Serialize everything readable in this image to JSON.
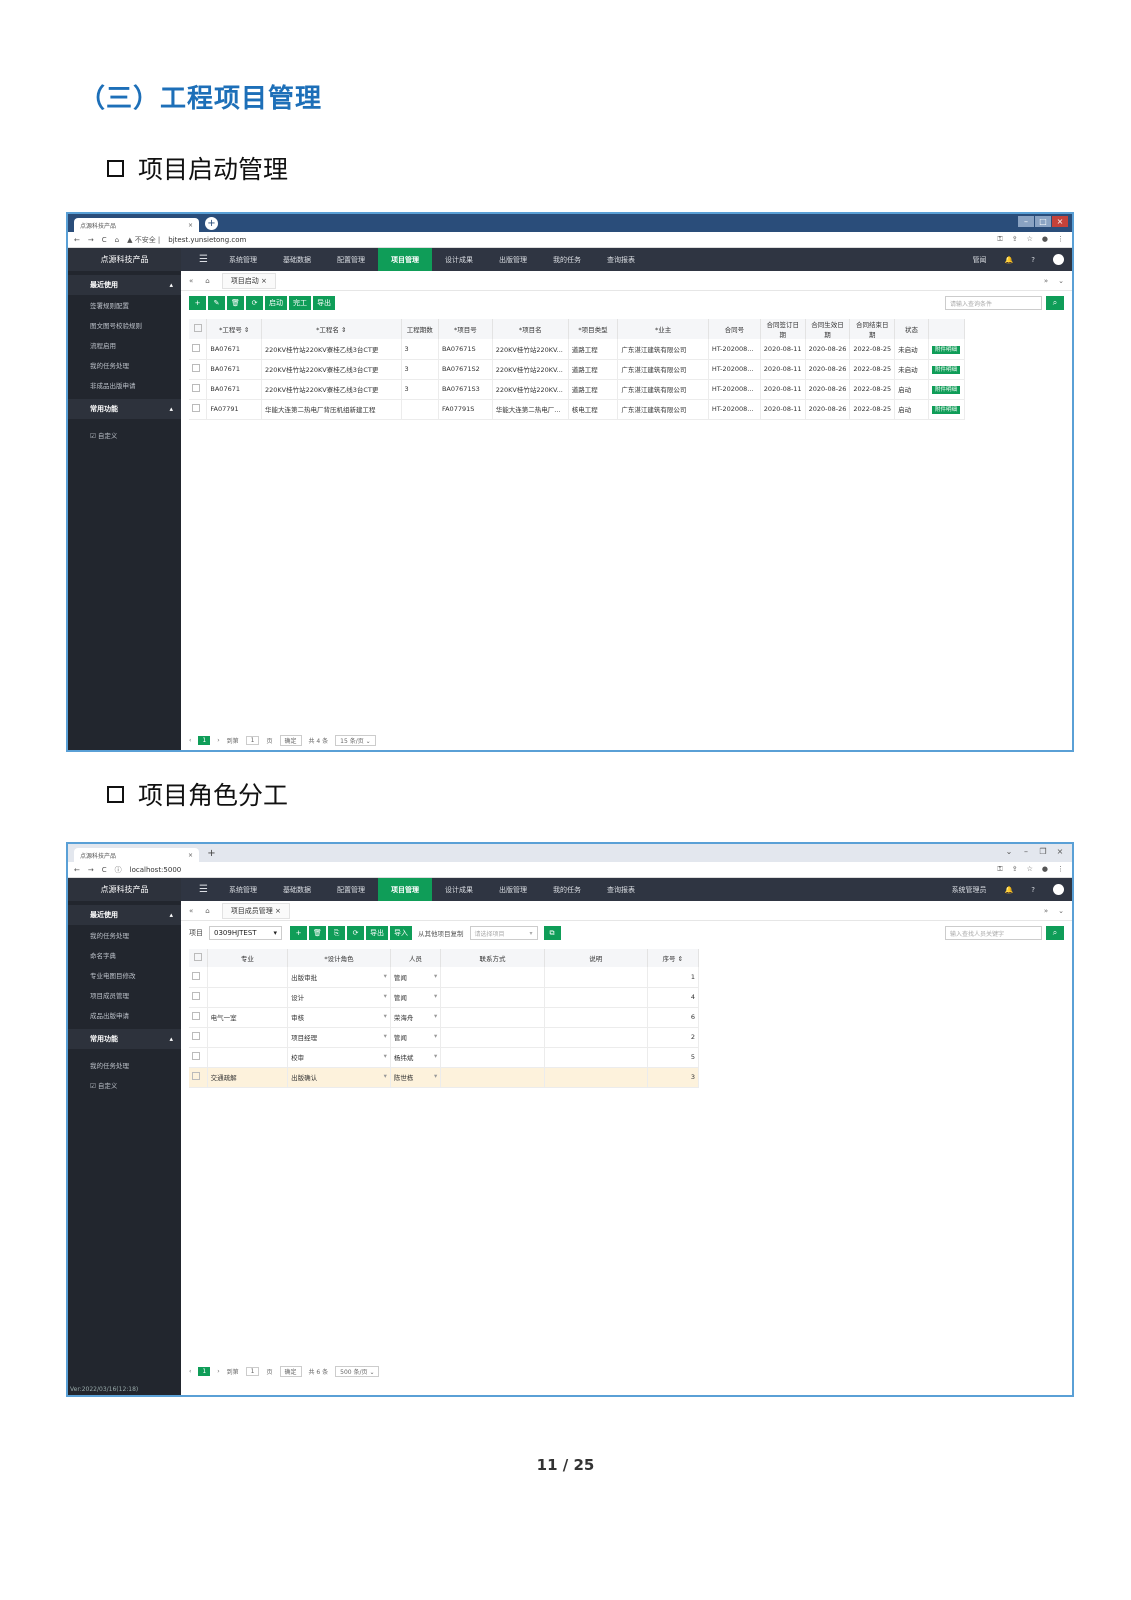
{
  "section_title": "（三）工程项目管理",
  "headings": [
    "项目启动管理",
    "项目角色分工"
  ],
  "shot1": {
    "tab_title": "点源科技产品",
    "url_prefix": "▲ 不安全 |",
    "url": "bjtest.yunsietong.com",
    "brand": "点源科技产品",
    "nav": [
      "系统管理",
      "基础数据",
      "配置管理",
      "项目管理",
      "设计成果",
      "出版管理",
      "我的任务",
      "查询报表"
    ],
    "nav_active": "项目管理",
    "user": "管闻",
    "side_group1": "最近使用",
    "side_items": [
      "签署规则配置",
      "图文图号校验规则",
      "流程启用",
      "我的任务处理",
      "非成品出版申请"
    ],
    "side_group2": "常用功能",
    "side_items2": [
      "☑ 自定义"
    ],
    "crumb_tab": "项目启动",
    "toolbar": [
      "+",
      "✎",
      "🗑",
      "⟳",
      "启动",
      "完工",
      "导出"
    ],
    "search_placeholder": "请输入查询条件",
    "columns": [
      "*工程号 ⇕",
      "*工程名 ⇕",
      "工程期数",
      "*项目号",
      "*项目名",
      "*项目类型",
      "*业主",
      "合同号",
      "合同签订日期",
      "合同生效日期",
      "合同结束日期",
      "状态",
      ""
    ],
    "rows": [
      [
        "BA07671",
        "220KV桂竹站220KV寮桂乙线3台CT更",
        "3",
        "BA07671S",
        "220KV桂竹站220KV...",
        "道路工程",
        "广东湛江建筑有限公司",
        "HT-202008...",
        "2020-08-11",
        "2020-08-26",
        "2022-08-25",
        "未启动",
        "附件明细"
      ],
      [
        "BA07671",
        "220KV桂竹站220KV寮桂乙线3台CT更",
        "3",
        "BA07671S2",
        "220KV桂竹站220KV...",
        "道路工程",
        "广东湛江建筑有限公司",
        "HT-202008...",
        "2020-08-11",
        "2020-08-26",
        "2022-08-25",
        "未启动",
        "附件明细"
      ],
      [
        "BA07671",
        "220KV桂竹站220KV寮桂乙线3台CT更",
        "3",
        "BA07671S3",
        "220KV桂竹站220KV...",
        "道路工程",
        "广东湛江建筑有限公司",
        "HT-202008...",
        "2020-08-11",
        "2020-08-26",
        "2022-08-25",
        "启动",
        "附件明细"
      ],
      [
        "FA07791",
        "华能大连第二热电厂背压机组新建工程",
        "",
        "FA07791S",
        "华能大连第二热电厂...",
        "核电工程",
        "广东湛江建筑有限公司",
        "HT-202008...",
        "2020-08-11",
        "2020-08-26",
        "2022-08-25",
        "启动",
        "附件明细"
      ]
    ],
    "pager": {
      "current": "1",
      "goto": "到第",
      "page_input": "1",
      "page": "页",
      "confirm": "确定",
      "total": "共 4 条",
      "size": "15 条/页 ⌄"
    }
  },
  "shot2": {
    "tab_title": "点源科技产品",
    "url_prefix": "ⓘ",
    "url": "localhost:5000",
    "brand": "点源科技产品",
    "nav": [
      "系统管理",
      "基础数据",
      "配置管理",
      "项目管理",
      "设计成果",
      "出版管理",
      "我的任务",
      "查询报表"
    ],
    "user": "系统管理员",
    "side_group1": "最近使用",
    "side_items": [
      "我的任务处理",
      "命名字典",
      "专业电图目修改",
      "项目成员管理",
      "成品出版申请"
    ],
    "side_group2": "常用功能",
    "side_items2": [
      "我的任务处理",
      "☑ 自定义"
    ],
    "footer": "Ver:2022/03/16(12:18)",
    "crumb_tab": "项目成员管理",
    "project_label": "项目",
    "project_value": "0309HJTEST",
    "toolbar": [
      "+",
      "🗑",
      "⎘",
      "⟳",
      "导出",
      "导入"
    ],
    "copy_text": "从其他项目复制",
    "copy_placeholder": "请选择项目",
    "search_placeholder": "输入查找人员关键字",
    "columns": [
      "",
      "专业",
      "*设计角色",
      "人员",
      "联系方式",
      "说明",
      "序号 ⇕"
    ],
    "rows": [
      [
        "",
        "出版审批",
        "管闻",
        "",
        "",
        "1"
      ],
      [
        "",
        "设计",
        "管闻",
        "",
        "",
        "4"
      ],
      [
        "电气一室",
        "审核",
        "荣海舟",
        "",
        "",
        "6"
      ],
      [
        "",
        "项目经理",
        "管闻",
        "",
        "",
        "2"
      ],
      [
        "",
        "校审",
        "杨纬斌",
        "",
        "",
        "5"
      ],
      [
        "交通疏解",
        "出版确认",
        "陈世栋",
        "",
        "",
        "3"
      ]
    ],
    "pager": {
      "current": "1",
      "goto": "到第",
      "page_input": "1",
      "page": "页",
      "confirm": "确定",
      "total": "共 6 条",
      "size": "500 条/页 ⌄"
    }
  },
  "page_number": "11 / 25"
}
